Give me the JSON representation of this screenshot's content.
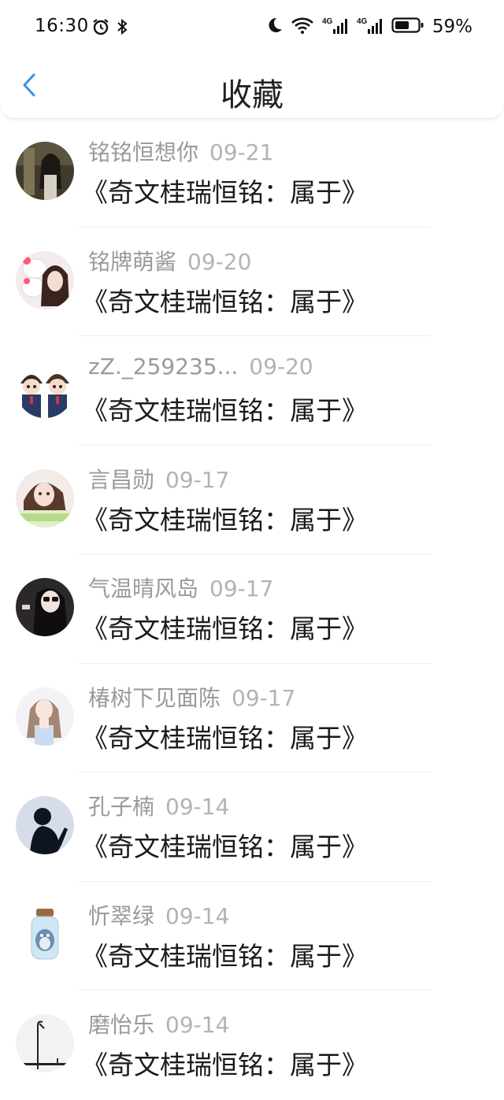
{
  "status_bar": {
    "time": "16:30",
    "battery": "59%",
    "icons": [
      "alarm-icon",
      "bluetooth-icon",
      "moon-icon",
      "wifi-icon",
      "signal-4g-icon",
      "signal-4g-icon",
      "battery-icon"
    ]
  },
  "header": {
    "title": "收藏",
    "back_icon": "chevron-left-icon"
  },
  "items": [
    {
      "name": "铭铭恒想你",
      "date": "09-21",
      "content": "《奇文桂瑞恒铭：属于》"
    },
    {
      "name": "铭牌萌酱",
      "date": "09-20",
      "content": "《奇文桂瑞恒铭：属于》"
    },
    {
      "name": "zZ._259235...",
      "date": "09-20",
      "content": "《奇文桂瑞恒铭：属于》"
    },
    {
      "name": "言昌勋",
      "date": "09-17",
      "content": "《奇文桂瑞恒铭：属于》"
    },
    {
      "name": "气温晴风岛",
      "date": "09-17",
      "content": "《奇文桂瑞恒铭：属于》"
    },
    {
      "name": "椿树下见面陈",
      "date": "09-17",
      "content": "《奇文桂瑞恒铭：属于》"
    },
    {
      "name": "孔子楠",
      "date": "09-14",
      "content": "《奇文桂瑞恒铭：属于》"
    },
    {
      "name": "忻翠绿",
      "date": "09-14",
      "content": "《奇文桂瑞恒铭：属于》"
    },
    {
      "name": "磨怡乐",
      "date": "09-14",
      "content": "《奇文桂瑞恒铭：属于》"
    }
  ],
  "colors": {
    "accent": "#3d8fe8",
    "meta": "#9a9a9a",
    "content": "#1a1a1a"
  }
}
